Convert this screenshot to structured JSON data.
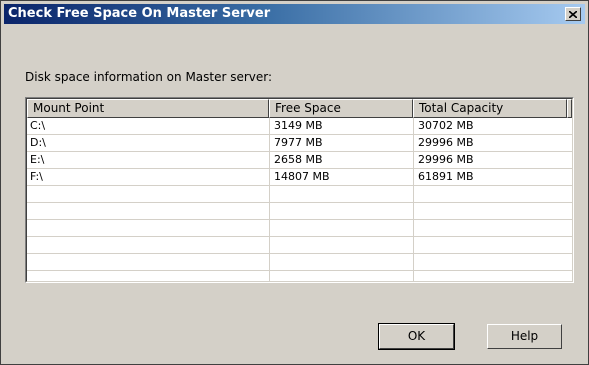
{
  "window": {
    "title": "Check Free Space On Master Server"
  },
  "prompt": "Disk space information on Master server:",
  "table": {
    "columns": [
      "Mount Point",
      "Free Space",
      "Total Capacity"
    ],
    "rows": [
      [
        "C:\\",
        "3149 MB",
        "30702 MB"
      ],
      [
        "D:\\",
        "7977 MB",
        "29996 MB"
      ],
      [
        "E:\\",
        "2658 MB",
        "29996 MB"
      ],
      [
        "F:\\",
        "14807 MB",
        "61891 MB"
      ]
    ]
  },
  "buttons": {
    "ok": "OK",
    "help": "Help"
  },
  "icons": {
    "close": "close-icon"
  }
}
